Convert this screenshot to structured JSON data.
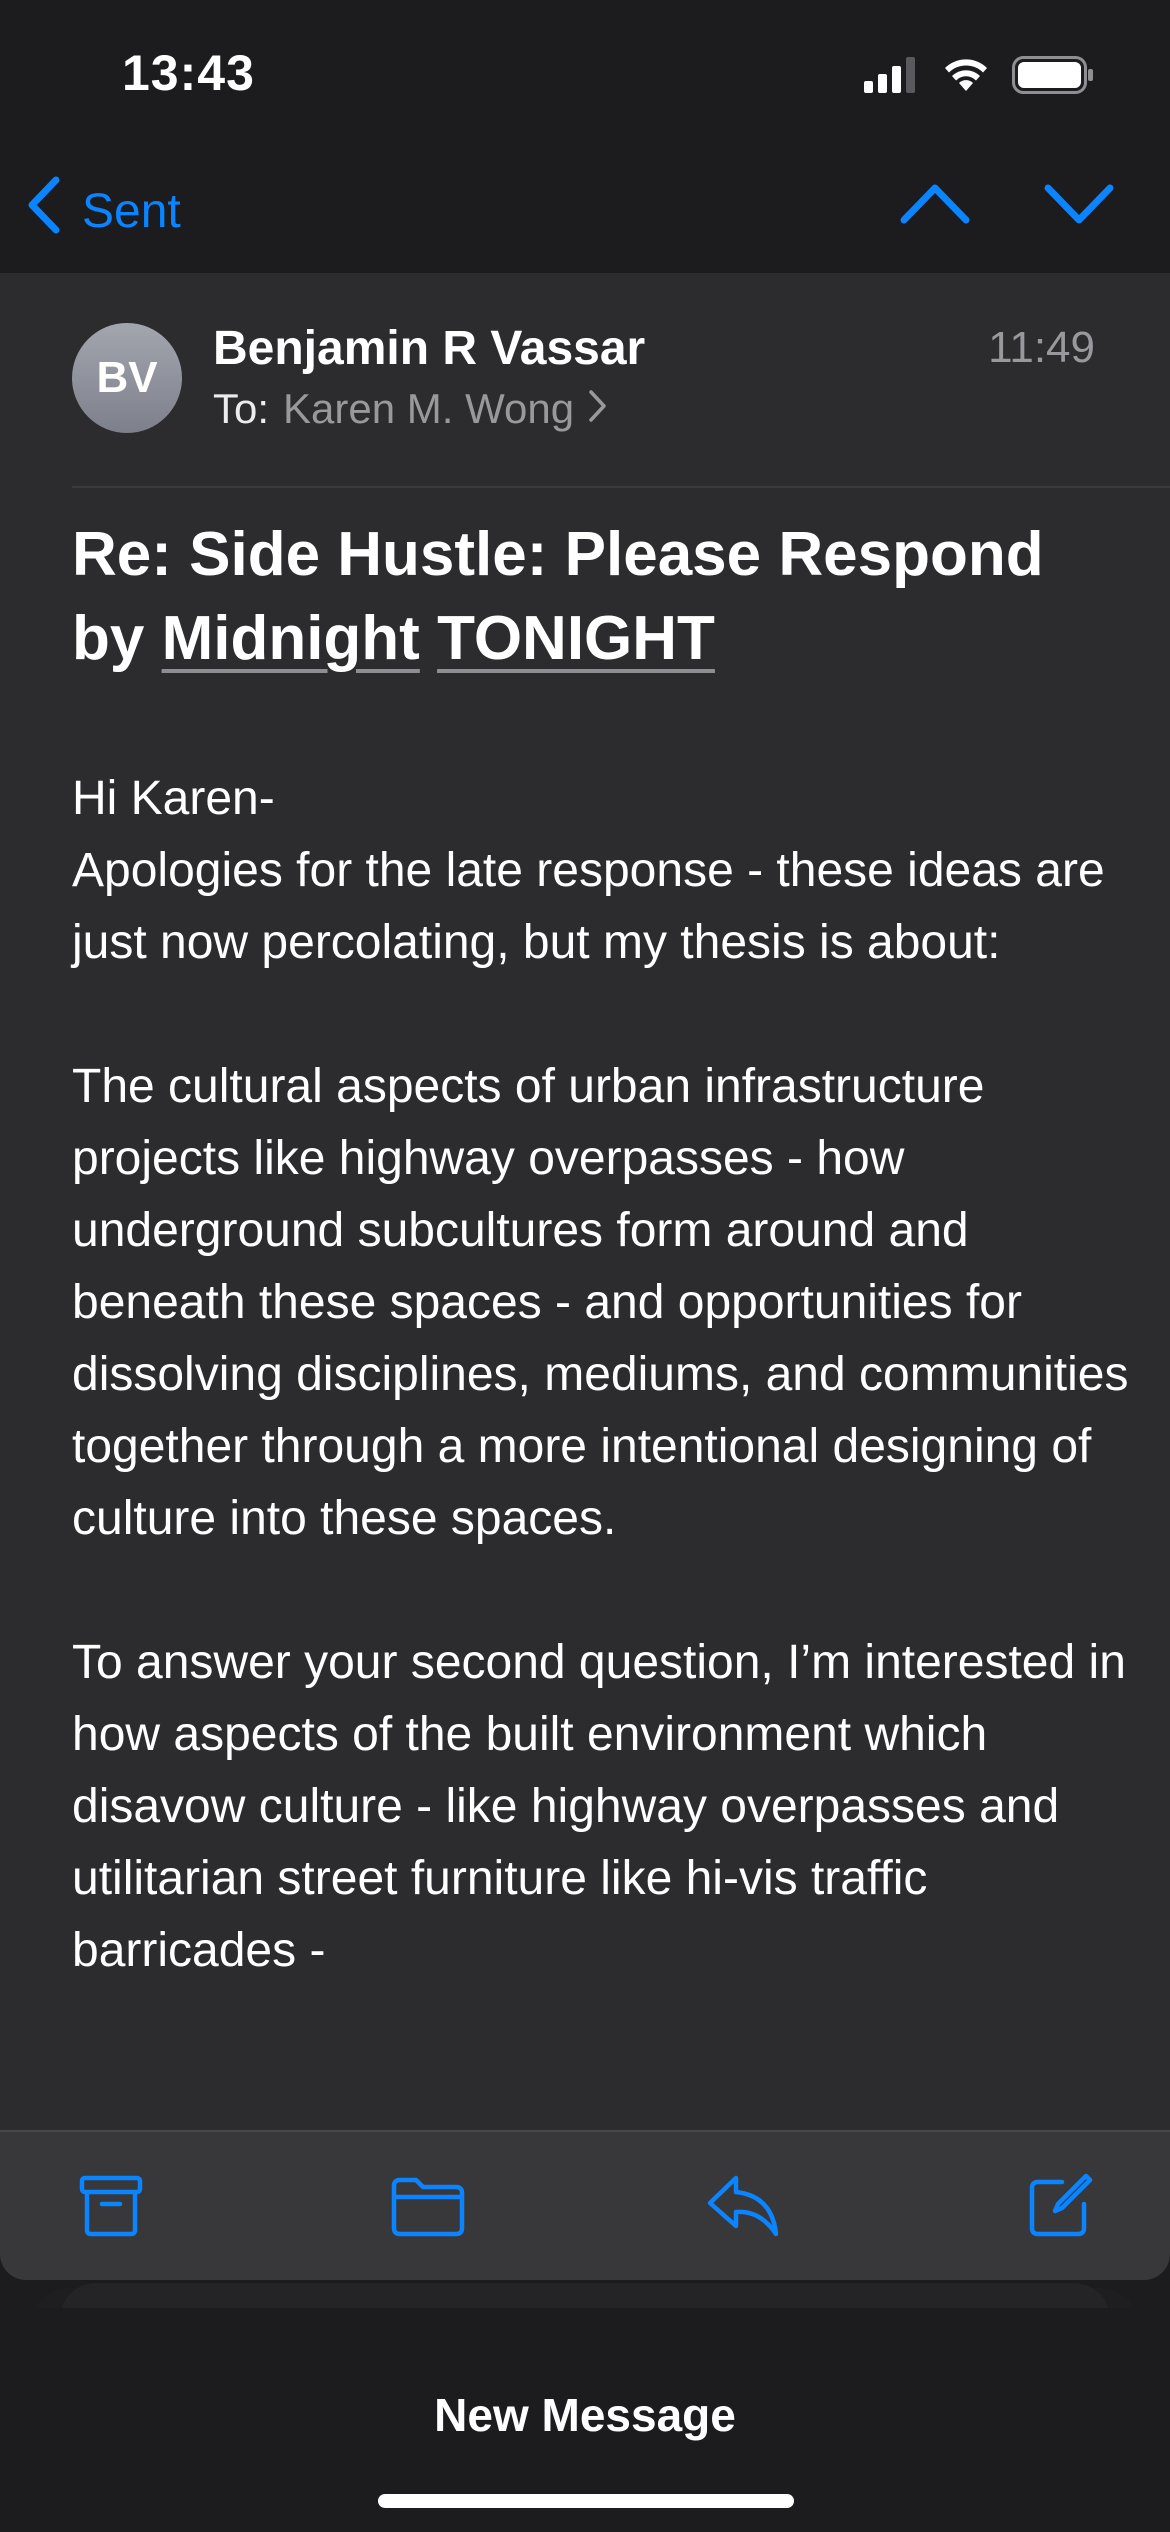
{
  "status_bar": {
    "time": "13:43",
    "icons": [
      "cellular-signal-icon",
      "wifi-icon",
      "battery-icon"
    ]
  },
  "nav": {
    "back_label": "Sent",
    "icons": [
      "chevron-left-icon",
      "chevron-up-icon",
      "chevron-down-icon"
    ]
  },
  "message": {
    "avatar_initials": "BV",
    "sender": "Benjamin R Vassar",
    "time": "11:49",
    "to_label": "To:",
    "recipient": "Karen M. Wong",
    "subject_prefix": "Re: Side Hustle: Please Respond by",
    "subject_link1": "Midnight",
    "subject_link2": "TONIGHT",
    "greeting": "Hi Karen-",
    "paragraph1": "Apologies for the late response - these ideas are just now percolating, but my thesis is about:",
    "paragraph2": "The cultural aspects of urban infrastructure projects like highway overpasses - how underground subcultures form around and beneath these spaces - and opportunities for dissolving disciplines, mediums, and communities together through a more intentional designing of culture into these spaces.",
    "paragraph3": "To answer your second question, I’m interested in how aspects of the built environment which disavow culture - like highway overpasses and utilitarian street furniture like hi-vis traffic barricades -"
  },
  "toolbar": {
    "icons": [
      "archive-icon",
      "folder-icon",
      "reply-icon",
      "compose-icon"
    ]
  },
  "sheet": {
    "title": "New Message"
  },
  "colors": {
    "accent": "#0a84ff",
    "background": "#1c1c1e",
    "card": "#2c2c2e",
    "secondary_text": "#98989d"
  }
}
